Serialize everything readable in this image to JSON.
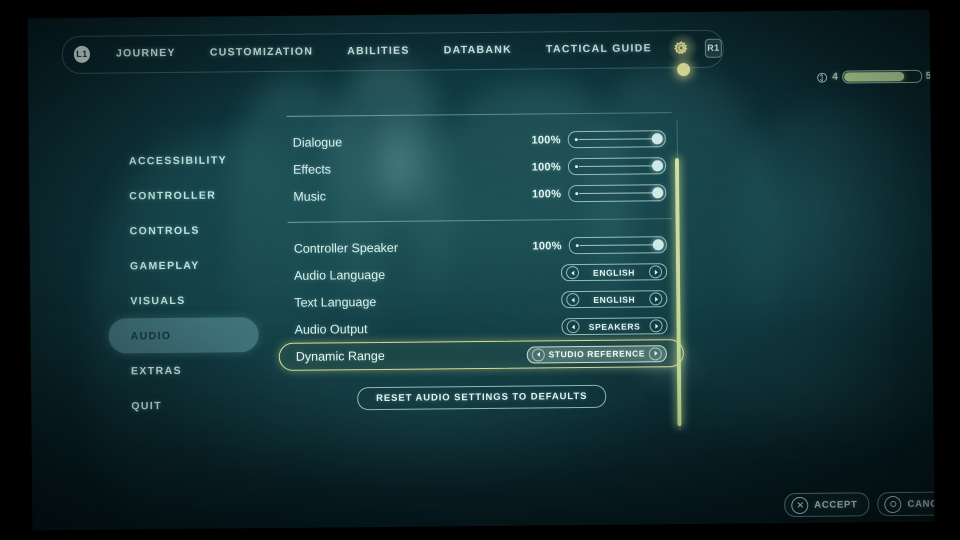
{
  "nav": {
    "left_bumper": "L1",
    "right_bumper": "R1",
    "tabs": [
      {
        "label": "JOURNEY"
      },
      {
        "label": "CUSTOMIZATION"
      },
      {
        "label": "ABILITIES"
      },
      {
        "label": "DATABANK"
      },
      {
        "label": "TACTICAL GUIDE"
      }
    ],
    "settings_icon": "gear-icon"
  },
  "meter": {
    "icon": "brightness-icon",
    "current": "4",
    "max": "5",
    "fill_percent": 78
  },
  "sidebar": {
    "items": [
      {
        "label": "ACCESSIBILITY",
        "selected": false
      },
      {
        "label": "CONTROLLER",
        "selected": false
      },
      {
        "label": "CONTROLS",
        "selected": false
      },
      {
        "label": "GAMEPLAY",
        "selected": false
      },
      {
        "label": "VISUALS",
        "selected": false
      },
      {
        "label": "AUDIO",
        "selected": true
      },
      {
        "label": "EXTRAS",
        "selected": false
      },
      {
        "label": "QUIT",
        "selected": false
      }
    ]
  },
  "settings": {
    "group1": [
      {
        "label": "Dialogue",
        "type": "slider",
        "value": "100%",
        "fill": 100
      },
      {
        "label": "Effects",
        "type": "slider",
        "value": "100%",
        "fill": 100
      },
      {
        "label": "Music",
        "type": "slider",
        "value": "100%",
        "fill": 100
      }
    ],
    "group2": [
      {
        "label": "Controller Speaker",
        "type": "slider",
        "value": "100%",
        "fill": 100,
        "selected": false
      },
      {
        "label": "Audio Language",
        "type": "chooser",
        "value": "ENGLISH",
        "selected": false
      },
      {
        "label": "Text Language",
        "type": "chooser",
        "value": "ENGLISH",
        "selected": false
      },
      {
        "label": "Audio Output",
        "type": "chooser",
        "value": "SPEAKERS",
        "selected": false
      },
      {
        "label": "Dynamic Range",
        "type": "chooser",
        "value": "STUDIO REFERENCE",
        "selected": true
      }
    ],
    "reset_label": "RESET AUDIO SETTINGS TO DEFAULTS"
  },
  "actions": [
    {
      "label": "ACCEPT",
      "icon": "cross-button-icon"
    },
    {
      "label": "CANCEL",
      "icon": "circle-button-icon"
    }
  ],
  "colors": {
    "accent_gold": "#d8dd96",
    "accent_teal": "#96d7e1",
    "text_primary": "#daf0ed",
    "background_teal": "#103b42"
  }
}
